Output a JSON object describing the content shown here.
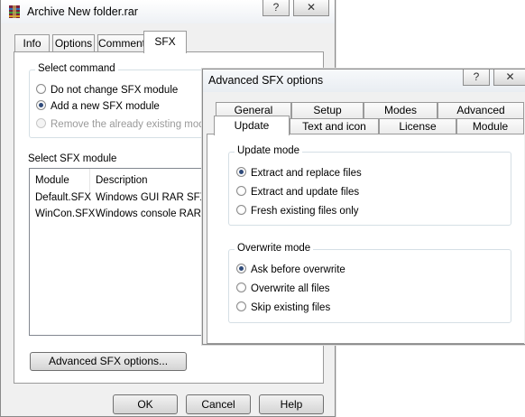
{
  "main_window": {
    "title": "Archive New folder.rar",
    "help_glyph": "?",
    "close_glyph": "✕",
    "tabs": [
      "Info",
      "Options",
      "Comment",
      "SFX"
    ],
    "select_command": {
      "legend": "Select command",
      "options": [
        {
          "label": "Do not change SFX module",
          "checked": false,
          "disabled": false
        },
        {
          "label": "Add a new SFX module",
          "checked": true,
          "disabled": false
        },
        {
          "label": "Remove the already existing module",
          "checked": false,
          "disabled": true
        }
      ]
    },
    "sfx_module": {
      "label": "Select SFX module",
      "columns": [
        "Module",
        "Description"
      ],
      "rows": [
        {
          "module": "Default.SFX",
          "description": "Windows GUI RAR SFX"
        },
        {
          "module": "WinCon.SFX",
          "description": "Windows console RAR SFX"
        }
      ]
    },
    "advanced_button": "Advanced SFX options...",
    "buttons": {
      "ok": "OK",
      "cancel": "Cancel",
      "help": "Help"
    }
  },
  "advanced_dialog": {
    "title": "Advanced SFX options",
    "help_glyph": "?",
    "close_glyph": "✕",
    "tabs_row1": [
      "General",
      "Setup",
      "Modes",
      "Advanced"
    ],
    "tabs_row2": [
      "Update",
      "Text and icon",
      "License",
      "Module"
    ],
    "update_mode": {
      "legend": "Update mode",
      "options": [
        {
          "label": "Extract and replace files",
          "checked": true
        },
        {
          "label": "Extract and update files",
          "checked": false
        },
        {
          "label": "Fresh existing files only",
          "checked": false
        }
      ]
    },
    "overwrite_mode": {
      "legend": "Overwrite mode",
      "options": [
        {
          "label": "Ask before overwrite",
          "checked": true
        },
        {
          "label": "Overwrite all files",
          "checked": false
        },
        {
          "label": "Skip existing files",
          "checked": false
        }
      ]
    }
  },
  "icons": {
    "app": "winrar-archive-icon"
  }
}
